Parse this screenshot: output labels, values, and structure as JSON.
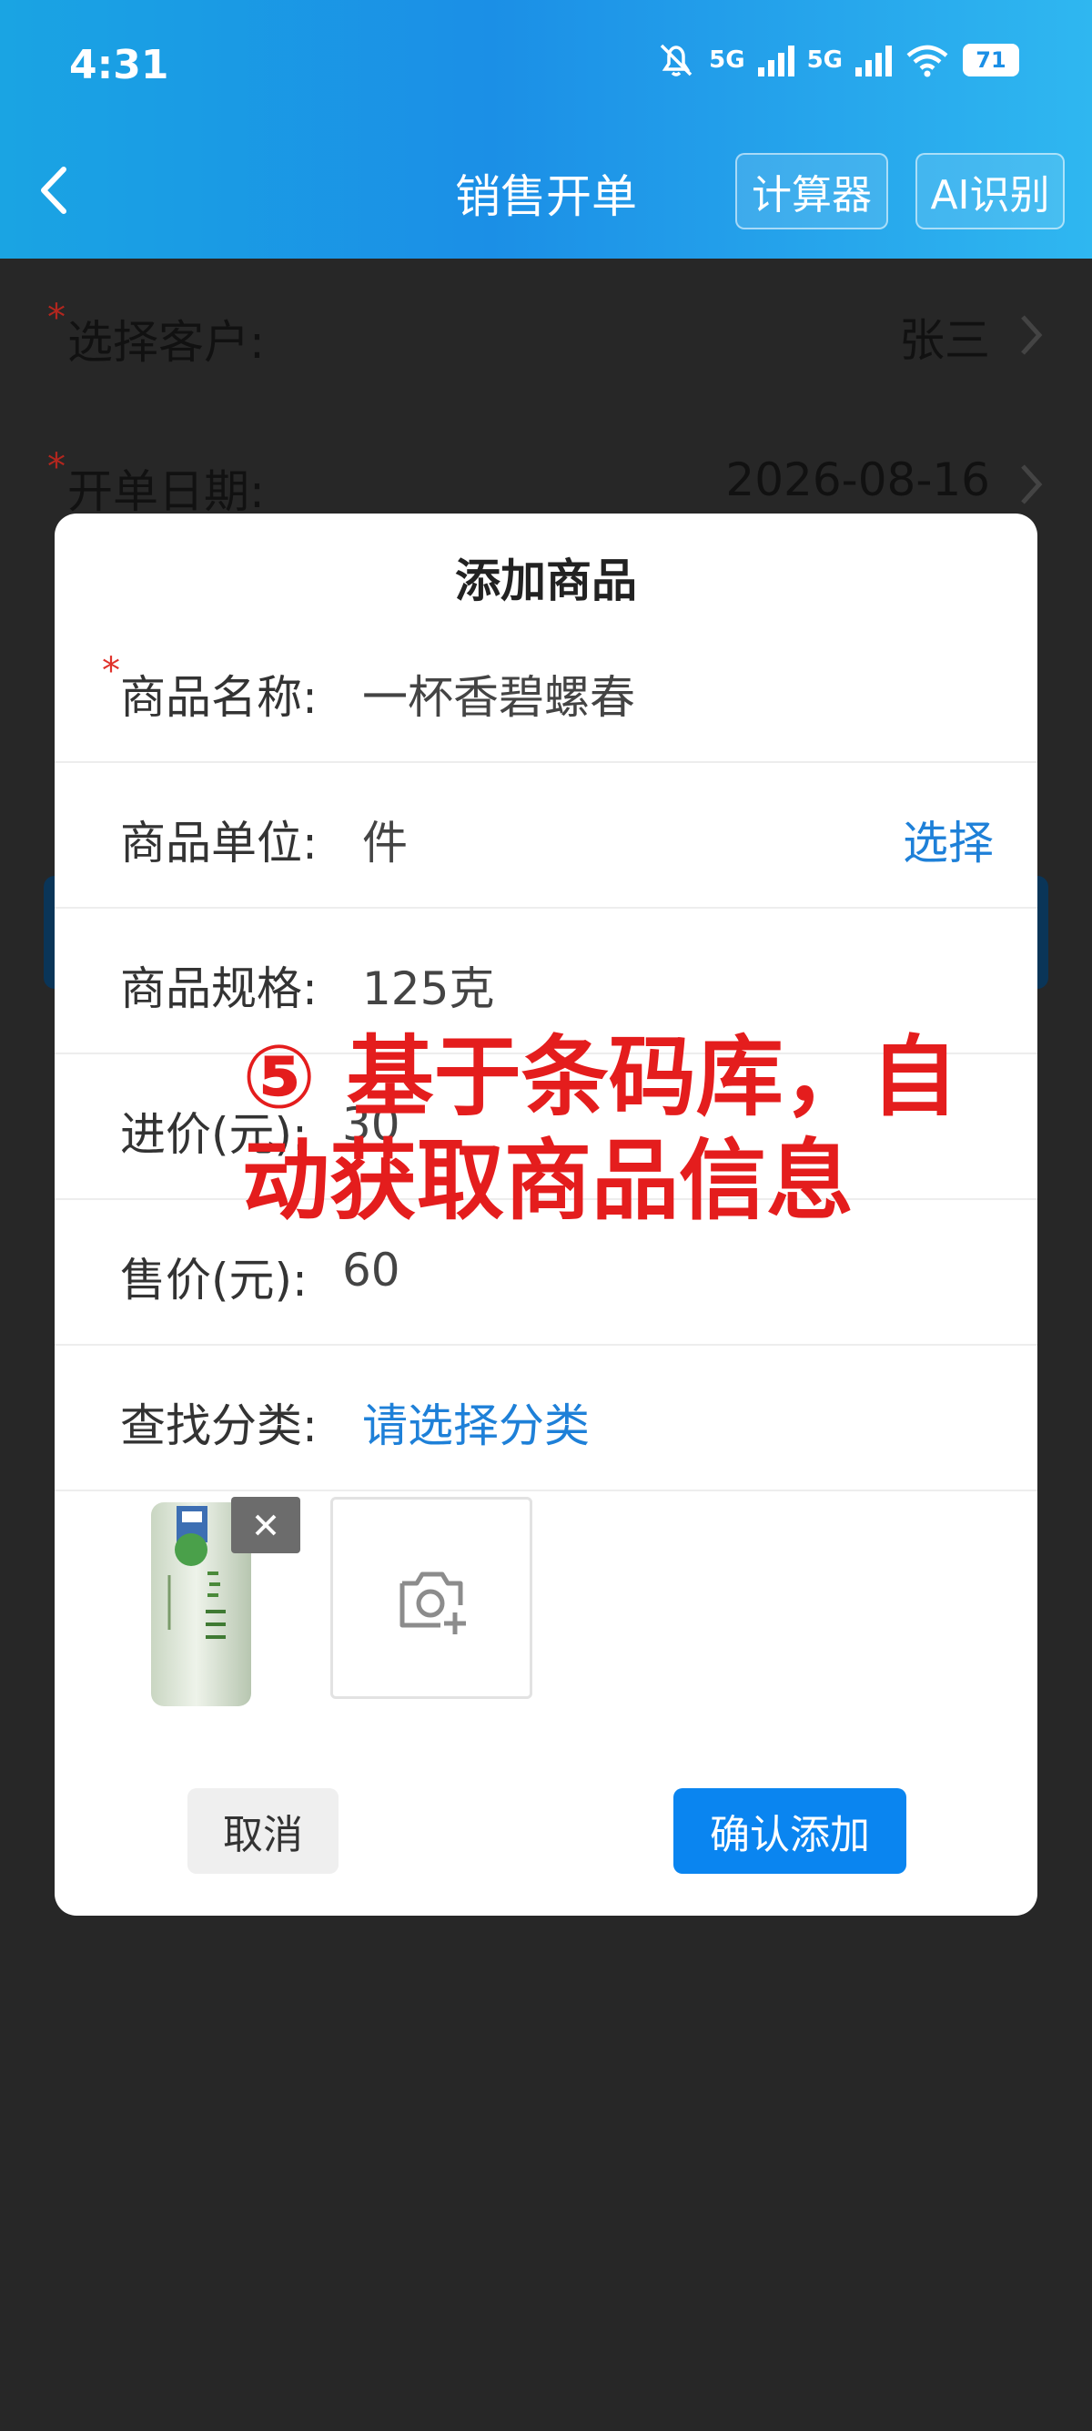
{
  "status_bar": {
    "time": "4:31",
    "network_1": "5G",
    "network_2": "5G",
    "battery": "71"
  },
  "header": {
    "title": "销售开单",
    "calculator_label": "计算器",
    "ai_label": "AI识别"
  },
  "background_form": {
    "customer": {
      "label": "选择客户:",
      "value": "张三",
      "required": "*"
    },
    "date": {
      "label": "开单日期:",
      "value": "2026-08-16",
      "required": "*"
    }
  },
  "dialog": {
    "title": "添加商品",
    "fields": {
      "name": {
        "required": "*",
        "label": "商品名称:",
        "value": "一杯香碧螺春"
      },
      "unit": {
        "label": "商品单位:",
        "value": "件",
        "action": "选择"
      },
      "spec": {
        "label": "商品规格:",
        "value": "125克"
      },
      "purchase_price": {
        "label": "进价(元):",
        "value": "30"
      },
      "sale_price": {
        "label": "售价(元):",
        "value": "60"
      },
      "category": {
        "label": "查找分类:",
        "value": "请选择分类"
      }
    },
    "cancel_label": "取消",
    "confirm_label": "确认添加"
  },
  "annotation": {
    "line1": "⑤ 基于条码库，自",
    "line2": "动获取商品信息"
  },
  "colors": {
    "accent_blue": "#0a85f0",
    "link_blue": "#1e80d8",
    "annotation_red": "#e41d1d",
    "required_red": "#e0322b"
  }
}
